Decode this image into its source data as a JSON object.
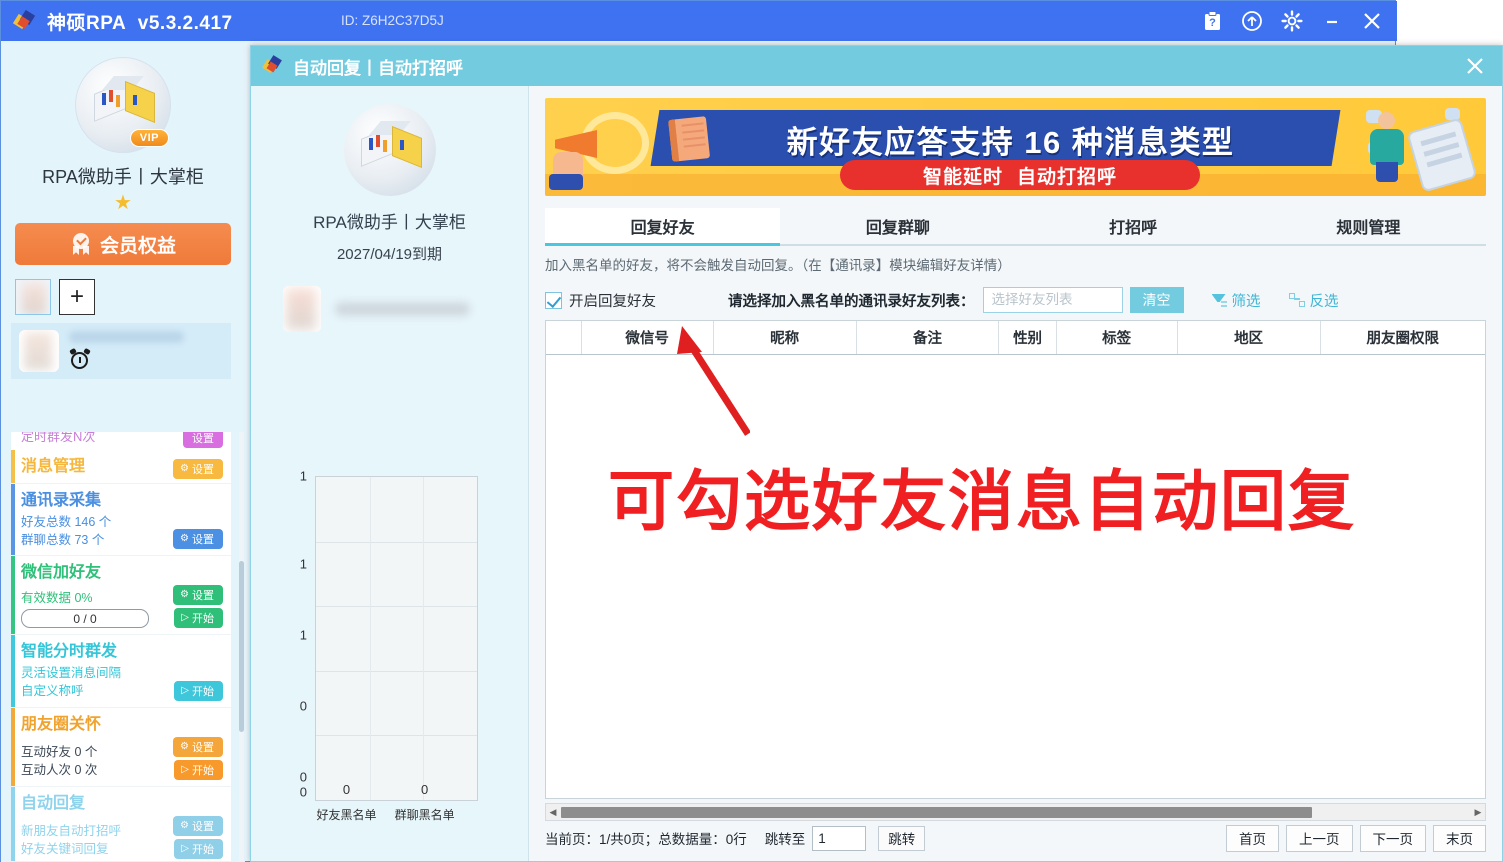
{
  "titlebar": {
    "app_name": "神硕RPA",
    "version": "v5.3.2.417",
    "id_label": "ID: Z6H2C37D5J",
    "controls": [
      {
        "name": "help-icon",
        "glyph": "?"
      },
      {
        "name": "upload-icon",
        "glyph": "↑"
      },
      {
        "name": "gear-icon",
        "glyph": "⚙"
      },
      {
        "name": "minimize-icon",
        "glyph": "–"
      },
      {
        "name": "close-icon",
        "glyph": "✕"
      }
    ]
  },
  "sidebar": {
    "vip_badge": "VIP",
    "profile_name": "RPA微助手丨大掌柜",
    "star": "★",
    "member_benefits": "会员权益",
    "add_account": "+",
    "scrolled_top_text": "定时群发N次",
    "modules": [
      {
        "title": "消息管理",
        "color": "#f5b73c",
        "bar": "#f5c04a",
        "lines": [],
        "buttons": [
          {
            "label": "设置",
            "icon": "gear",
            "color": "#f7b93f"
          }
        ]
      },
      {
        "title": "通讯录采集",
        "color": "#4a8fe0",
        "bar": "#5a95e3",
        "lines": [
          "好友总数 146 个",
          "群聊总数 73 个"
        ],
        "line_color": "#4a8fe0",
        "buttons": [
          {
            "label": "设置",
            "icon": "gear",
            "color": "#4b90e2"
          }
        ]
      },
      {
        "title": "微信加好友",
        "color": "#2fc07a",
        "bar": "#35c481",
        "lines": [
          "有效数据 0%"
        ],
        "line_color": "#2fc07a",
        "progress": "0 / 0",
        "buttons": [
          {
            "label": "设置",
            "icon": "gear",
            "color": "#2fbf79"
          },
          {
            "label": "开始",
            "icon": "play",
            "color": "#2fbf79"
          }
        ]
      },
      {
        "title": "智能分时群发",
        "color": "#34c6d8",
        "bar": "#3fc9da",
        "lines": [
          "灵活设置消息间隔",
          "自定义称呼"
        ],
        "line_color": "#34c6d8",
        "buttons": [
          {
            "label": "开始",
            "icon": "play",
            "color": "#3ec7da"
          }
        ]
      },
      {
        "title": "朋友圈关怀",
        "color": "#f0a game",
        "bar": "#f2a93a",
        "lines": [
          "互动好友 0 个",
          "互动人次 0 次"
        ],
        "line_color": "#3b4856",
        "buttons": [
          {
            "label": "设置",
            "icon": "gear",
            "color": "#f4a63a"
          },
          {
            "label": "开始",
            "icon": "play",
            "color": "#f79a2b"
          }
        ]
      },
      {
        "title": "自动回复",
        "color": "#8fd3ec",
        "bar": "#8fd3ec",
        "lines": [
          "新朋友自动打招呼",
          "好友关键词回复"
        ],
        "line_color": "#8fd3ec",
        "buttons": [
          {
            "label": "设置",
            "icon": "gear",
            "color": "#8fcfe8"
          },
          {
            "label": "开始",
            "icon": "play",
            "color": "#8fcfe8"
          }
        ]
      }
    ]
  },
  "dialog": {
    "title": "自动回复丨自动打招呼",
    "close": "✕",
    "left": {
      "profile_name": "RPA微助手丨大掌柜",
      "expiry": "2027/04/19到期"
    },
    "banner": {
      "main_text": "新好友应答支持 16 种消息类型",
      "sub_left": "智能延时",
      "sub_right": "自动打招呼"
    },
    "tabs": [
      {
        "label": "回复好友",
        "active": true
      },
      {
        "label": "回复群聊",
        "active": false
      },
      {
        "label": "打招呼",
        "active": false
      },
      {
        "label": "规则管理",
        "active": false
      }
    ],
    "hint": "加入黑名单的好友，将不会触发自动回复。（在【通讯录】模块编辑好友详情）",
    "toolbar": {
      "checkbox_label": "开启回复好友",
      "checkbox_checked": true,
      "prompt": "请选择加入黑名单的通讯录好友列表：",
      "select_placeholder": "选择好友列表",
      "clear_label": "清空",
      "filter_label": "筛选",
      "invert_label": "反选"
    },
    "table": {
      "columns": [
        "",
        "微信号",
        "昵称",
        "备注",
        "性别",
        "标签",
        "地区",
        "朋友圈权限"
      ],
      "rows": []
    },
    "pager": {
      "info": "当前页：1/共0页；总数据量：0行",
      "jump_label": "跳转至",
      "jump_value": "1",
      "go_label": "跳转",
      "first": "首页",
      "prev": "上一页",
      "next": "下一页",
      "last": "末页"
    }
  },
  "annotation": {
    "red_text": "可勾选好友消息自动回复",
    "arrow_color": "#e02020"
  },
  "chart_data": {
    "type": "bar",
    "categories": [
      "好友黑名单",
      "群聊黑名单"
    ],
    "values": [
      0,
      0
    ],
    "value_labels": [
      "0",
      "0"
    ],
    "title": "",
    "xlabel": "",
    "ylabel": "",
    "ylim": [
      0,
      1
    ],
    "yticks": [
      "0",
      "0",
      "0",
      "1",
      "1",
      "1"
    ],
    "grid": true,
    "legend": "none"
  }
}
